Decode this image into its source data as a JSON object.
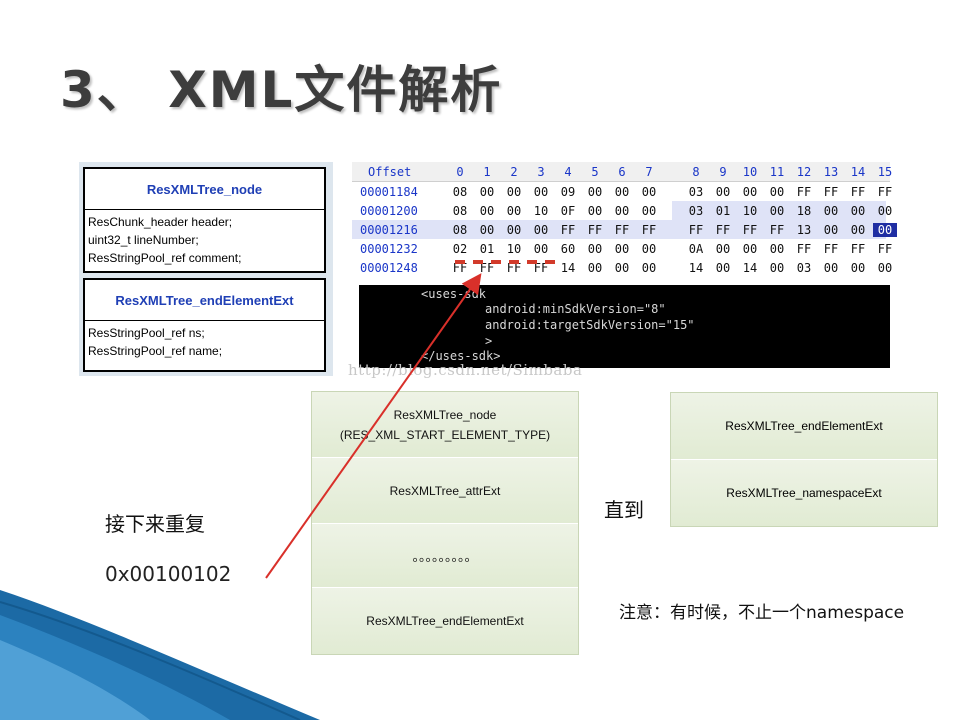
{
  "title": "3、 XML文件解析",
  "structs": [
    {
      "name": "ResXMLTree_node",
      "fields": [
        "ResChunk_header header;",
        "uint32_t lineNumber;",
        "ResStringPool_ref comment;"
      ]
    },
    {
      "name": "ResXMLTree_endElementExt",
      "fields": [
        "ResStringPool_ref ns;",
        "ResStringPool_ref name;"
      ]
    }
  ],
  "hex_table": {
    "header": {
      "offset": "Offset",
      "cols": [
        "0",
        "1",
        "2",
        "3",
        "4",
        "5",
        "6",
        "7",
        "8",
        "9",
        "10",
        "11",
        "12",
        "13",
        "14",
        "15"
      ]
    },
    "rows": [
      {
        "offset": "00001184",
        "bytes": [
          "08",
          "00",
          "00",
          "00",
          "09",
          "00",
          "00",
          "00",
          "03",
          "00",
          "00",
          "00",
          "FF",
          "FF",
          "FF",
          "FF"
        ]
      },
      {
        "offset": "00001200",
        "bytes": [
          "08",
          "00",
          "00",
          "10",
          "0F",
          "00",
          "00",
          "00",
          "03",
          "01",
          "10",
          "00",
          "18",
          "00",
          "00",
          "00"
        ]
      },
      {
        "offset": "00001216",
        "bytes": [
          "08",
          "00",
          "00",
          "00",
          "FF",
          "FF",
          "FF",
          "FF",
          "FF",
          "FF",
          "FF",
          "FF",
          "13",
          "00",
          "00",
          "00"
        ]
      },
      {
        "offset": "00001232",
        "bytes": [
          "02",
          "01",
          "10",
          "00",
          "60",
          "00",
          "00",
          "00",
          "0A",
          "00",
          "00",
          "00",
          "FF",
          "FF",
          "FF",
          "FF"
        ]
      },
      {
        "offset": "00001248",
        "bytes": [
          "FF",
          "FF",
          "FF",
          "FF",
          "14",
          "00",
          "00",
          "00",
          "14",
          "00",
          "14",
          "00",
          "03",
          "00",
          "00",
          "00"
        ]
      }
    ]
  },
  "code_lines": [
    "<uses-sdk",
    "android:minSdkVersion=\"8\"",
    "android:targetSdkVersion=\"15\"",
    ">",
    "</uses-sdk>"
  ],
  "watermark": "http://blog.csdn.net/Simbaba",
  "stack_left": [
    {
      "line1": "ResXMLTree_node",
      "line2": "(RES_XML_START_ELEMENT_TYPE)"
    },
    {
      "line1": "ResXMLTree_attrExt"
    },
    {
      "line1": "。。。。。。。。。"
    },
    {
      "line1": "ResXMLTree_endElementExt"
    }
  ],
  "stack_right": [
    {
      "line1": "ResXMLTree_endElementExt"
    },
    {
      "line1": "ResXMLTree_namespaceExt"
    }
  ],
  "label_repeat": "接下来重复",
  "hex_value": "0x00100102",
  "label_until": "直到",
  "note": "注意：有时候，不止一个namespace",
  "colors": {
    "title": "#3d3d3d",
    "struct_title": "#1f3fb5",
    "offset_blue": "#1a36c8",
    "arrow_red": "#d9302a",
    "box_green": "#e6eedb",
    "corner_blue": "#1c6aa5"
  }
}
